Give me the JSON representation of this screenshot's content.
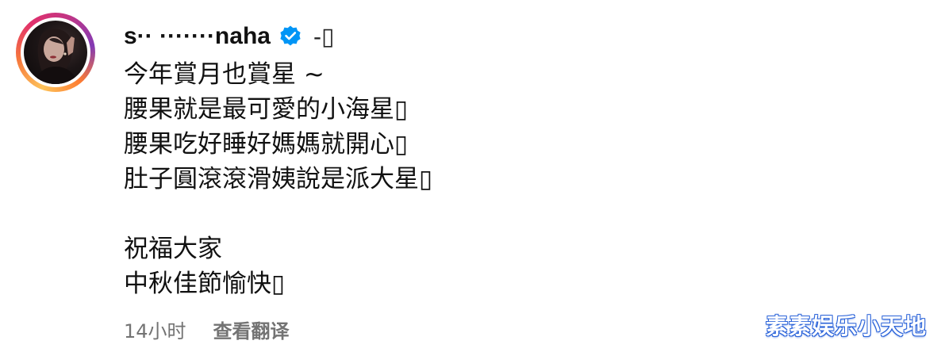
{
  "post": {
    "username": "s·· ·······naha",
    "suffix": "-▯",
    "caption_lines": [
      "今年賞月也賞星 ~",
      "腰果就是最可愛的小海星▯",
      "腰果吃好睡好媽媽就開心▯",
      "肚子圓滾滾滑姨說是派大星▯",
      "",
      "祝福大家",
      "中秋佳節愉快▯"
    ],
    "time_ago": "14小时",
    "translate_label": "查看翻译"
  },
  "watermark": "素素娱乐小天地",
  "colors": {
    "verified_blue": "#0095f6",
    "meta_gray": "#737373",
    "watermark_outline": "#2b63d9"
  },
  "icons": {
    "verified": "verified-badge-icon"
  }
}
